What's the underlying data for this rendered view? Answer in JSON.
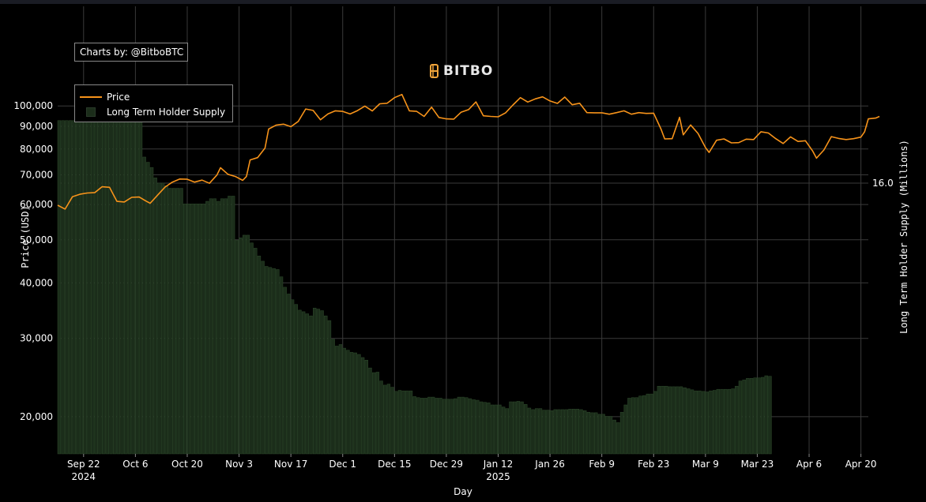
{
  "credit": "Charts by: @BitboBTC",
  "logo": {
    "text": "BITBO",
    "icon": "bitbo-logo-icon"
  },
  "legend": {
    "price_label": "Price",
    "supply_label": "Long Term Holder Supply"
  },
  "colors": {
    "price": "#f7931a",
    "bar_fill": "#1b2d1a",
    "bar_edge": "#2e4a2c",
    "grid": "#3a3a3a",
    "background": "#000000"
  },
  "chart_data": {
    "type": "bar+line",
    "xlabel": "Day",
    "y_left_label": "Price (USD)",
    "y_right_label": "Long Term Holder Supply (Millions)",
    "y_left_scale": "log",
    "y_left_ticks": [
      "20,000",
      "30,000",
      "40,000",
      "50,000",
      "60,000",
      "70,000",
      "80,000",
      "90,000",
      "100,000"
    ],
    "y_left_tick_values": [
      20000,
      30000,
      40000,
      50000,
      60000,
      70000,
      80000,
      90000,
      100000
    ],
    "y_left_range": [
      16500,
      115000
    ],
    "y_right_ticks": [
      "16.0"
    ],
    "y_right_tick_values": [
      16.0
    ],
    "y_right_range": [
      15.48,
      16.2
    ],
    "x_range": [
      "2024-09-15",
      "2025-04-22"
    ],
    "x_ticks": [
      {
        "date": "2024-09-22",
        "label": "Sep 22",
        "sub": "2024"
      },
      {
        "date": "2024-10-06",
        "label": "Oct 6",
        "sub": ""
      },
      {
        "date": "2024-10-20",
        "label": "Oct 20",
        "sub": ""
      },
      {
        "date": "2024-11-03",
        "label": "Nov 3",
        "sub": ""
      },
      {
        "date": "2024-11-17",
        "label": "Nov 17",
        "sub": ""
      },
      {
        "date": "2024-12-01",
        "label": "Dec 1",
        "sub": ""
      },
      {
        "date": "2024-12-15",
        "label": "Dec 15",
        "sub": ""
      },
      {
        "date": "2024-12-29",
        "label": "Dec 29",
        "sub": ""
      },
      {
        "date": "2025-01-12",
        "label": "Jan 12",
        "sub": "2025"
      },
      {
        "date": "2025-01-26",
        "label": "Jan 26",
        "sub": ""
      },
      {
        "date": "2025-02-09",
        "label": "Feb 9",
        "sub": ""
      },
      {
        "date": "2025-02-23",
        "label": "Feb 23",
        "sub": ""
      },
      {
        "date": "2025-03-09",
        "label": "Mar 9",
        "sub": ""
      },
      {
        "date": "2025-03-23",
        "label": "Mar 23",
        "sub": ""
      },
      {
        "date": "2025-04-06",
        "label": "Apr 6",
        "sub": ""
      },
      {
        "date": "2025-04-20",
        "label": "Apr 20",
        "sub": ""
      }
    ],
    "series": [
      {
        "name": "Price",
        "type": "line",
        "points": [
          [
            "2024-09-15",
            59800
          ],
          [
            "2024-09-17",
            58600
          ],
          [
            "2024-09-19",
            62500
          ],
          [
            "2024-09-21",
            63300
          ],
          [
            "2024-09-23",
            63700
          ],
          [
            "2024-09-25",
            63800
          ],
          [
            "2024-09-27",
            65800
          ],
          [
            "2024-09-29",
            65600
          ],
          [
            "2024-10-01",
            61000
          ],
          [
            "2024-10-03",
            60800
          ],
          [
            "2024-10-05",
            62300
          ],
          [
            "2024-10-07",
            62400
          ],
          [
            "2024-10-09",
            61000
          ],
          [
            "2024-10-10",
            60400
          ],
          [
            "2024-10-12",
            63000
          ],
          [
            "2024-10-14",
            65700
          ],
          [
            "2024-10-16",
            67400
          ],
          [
            "2024-10-18",
            68500
          ],
          [
            "2024-10-20",
            68400
          ],
          [
            "2024-10-22",
            67400
          ],
          [
            "2024-10-24",
            68100
          ],
          [
            "2024-10-26",
            67000
          ],
          [
            "2024-10-28",
            69900
          ],
          [
            "2024-10-29",
            72600
          ],
          [
            "2024-10-31",
            70200
          ],
          [
            "2024-11-02",
            69400
          ],
          [
            "2024-11-04",
            68000
          ],
          [
            "2024-11-05",
            69400
          ],
          [
            "2024-11-06",
            75600
          ],
          [
            "2024-11-08",
            76500
          ],
          [
            "2024-11-10",
            80400
          ],
          [
            "2024-11-11",
            88700
          ],
          [
            "2024-11-13",
            90500
          ],
          [
            "2024-11-15",
            91000
          ],
          [
            "2024-11-17",
            89800
          ],
          [
            "2024-11-19",
            92300
          ],
          [
            "2024-11-21",
            98400
          ],
          [
            "2024-11-23",
            97700
          ],
          [
            "2024-11-25",
            93100
          ],
          [
            "2024-11-27",
            95900
          ],
          [
            "2024-11-29",
            97500
          ],
          [
            "2024-12-01",
            97200
          ],
          [
            "2024-12-03",
            95900
          ],
          [
            "2024-12-05",
            97600
          ],
          [
            "2024-12-07",
            99900
          ],
          [
            "2024-12-09",
            97400
          ],
          [
            "2024-12-11",
            101100
          ],
          [
            "2024-12-13",
            101400
          ],
          [
            "2024-12-15",
            104400
          ],
          [
            "2024-12-17",
            106100
          ],
          [
            "2024-12-19",
            97500
          ],
          [
            "2024-12-21",
            97200
          ],
          [
            "2024-12-23",
            94700
          ],
          [
            "2024-12-25",
            99400
          ],
          [
            "2024-12-27",
            94200
          ],
          [
            "2024-12-29",
            93500
          ],
          [
            "2024-12-31",
            93400
          ],
          [
            "2025-01-02",
            96800
          ],
          [
            "2025-01-04",
            98100
          ],
          [
            "2025-01-06",
            102100
          ],
          [
            "2025-01-08",
            95000
          ],
          [
            "2025-01-10",
            94700
          ],
          [
            "2025-01-12",
            94500
          ],
          [
            "2025-01-14",
            96500
          ],
          [
            "2025-01-16",
            100500
          ],
          [
            "2025-01-18",
            104400
          ],
          [
            "2025-01-20",
            102000
          ],
          [
            "2025-01-22",
            103700
          ],
          [
            "2025-01-24",
            104800
          ],
          [
            "2025-01-26",
            102600
          ],
          [
            "2025-01-28",
            101300
          ],
          [
            "2025-01-30",
            104700
          ],
          [
            "2025-02-01",
            100600
          ],
          [
            "2025-02-03",
            101400
          ],
          [
            "2025-02-05",
            96600
          ],
          [
            "2025-02-07",
            96500
          ],
          [
            "2025-02-09",
            96500
          ],
          [
            "2025-02-11",
            95800
          ],
          [
            "2025-02-13",
            96600
          ],
          [
            "2025-02-15",
            97500
          ],
          [
            "2025-02-17",
            95800
          ],
          [
            "2025-02-19",
            96600
          ],
          [
            "2025-02-21",
            96200
          ],
          [
            "2025-02-23",
            96300
          ],
          [
            "2025-02-25",
            88700
          ],
          [
            "2025-02-26",
            84300
          ],
          [
            "2025-02-28",
            84400
          ],
          [
            "2025-03-02",
            94300
          ],
          [
            "2025-03-03",
            86100
          ],
          [
            "2025-03-05",
            90600
          ],
          [
            "2025-03-07",
            86700
          ],
          [
            "2025-03-09",
            80600
          ],
          [
            "2025-03-10",
            78600
          ],
          [
            "2025-03-12",
            83700
          ],
          [
            "2025-03-14",
            84300
          ],
          [
            "2025-03-16",
            82600
          ],
          [
            "2025-03-18",
            82700
          ],
          [
            "2025-03-20",
            84200
          ],
          [
            "2025-03-22",
            84000
          ],
          [
            "2025-03-24",
            87500
          ],
          [
            "2025-03-26",
            86900
          ],
          [
            "2025-03-28",
            84400
          ],
          [
            "2025-03-30",
            82300
          ],
          [
            "2025-04-01",
            85200
          ],
          [
            "2025-04-03",
            83200
          ],
          [
            "2025-04-05",
            83500
          ],
          [
            "2025-04-07",
            79100
          ],
          [
            "2025-04-08",
            76300
          ],
          [
            "2025-04-10",
            79600
          ],
          [
            "2025-04-12",
            85300
          ],
          [
            "2025-04-14",
            84500
          ],
          [
            "2025-04-16",
            84000
          ],
          [
            "2025-04-18",
            84400
          ],
          [
            "2025-04-20",
            85100
          ],
          [
            "2025-04-21",
            87500
          ],
          [
            "2025-04-22",
            93500
          ],
          [
            "2025-04-24",
            93900
          ],
          [
            "2025-04-25",
            94700
          ]
        ]
      },
      {
        "name": "Long Term Holder Supply",
        "type": "bar",
        "start": "2024-09-15",
        "step_days": 1,
        "values": [
          16.12,
          16.12,
          16.12,
          16.12,
          16.12,
          16.12,
          16.12,
          16.125,
          16.128,
          16.13,
          16.125,
          16.12,
          16.12,
          16.12,
          16.12,
          16.12,
          16.12,
          16.12,
          16.12,
          16.12,
          16.125,
          16.125,
          16.125,
          16.05,
          16.04,
          16.03,
          16.01,
          16.0,
          16.0,
          15.995,
          15.99,
          15.99,
          15.99,
          15.99,
          15.96,
          15.96,
          15.96,
          15.96,
          15.96,
          15.96,
          15.965,
          15.97,
          15.97,
          15.965,
          15.97,
          15.97,
          15.975,
          15.975,
          15.89,
          15.895,
          15.9,
          15.9,
          15.885,
          15.875,
          15.86,
          15.85,
          15.84,
          15.838,
          15.836,
          15.834,
          15.82,
          15.8,
          15.787,
          15.776,
          15.767,
          15.756,
          15.753,
          15.749,
          15.745,
          15.76,
          15.758,
          15.755,
          15.745,
          15.736,
          15.7,
          15.687,
          15.69,
          15.683,
          15.679,
          15.675,
          15.674,
          15.671,
          15.665,
          15.66,
          15.645,
          15.636,
          15.637,
          15.62,
          15.612,
          15.614,
          15.608,
          15.6,
          15.602,
          15.601,
          15.601,
          15.601,
          15.59,
          15.588,
          15.587,
          15.587,
          15.589,
          15.589,
          15.587,
          15.587,
          15.585,
          15.585,
          15.585,
          15.586,
          15.589,
          15.589,
          15.588,
          15.586,
          15.584,
          15.583,
          15.58,
          15.579,
          15.578,
          15.574,
          15.574,
          15.574,
          15.57,
          15.567,
          15.58,
          15.58,
          15.581,
          15.58,
          15.575,
          15.568,
          15.565,
          15.567,
          15.567,
          15.564,
          15.564,
          15.563,
          15.565,
          15.565,
          15.565,
          15.565,
          15.566,
          15.566,
          15.566,
          15.565,
          15.563,
          15.56,
          15.559,
          15.559,
          15.556,
          15.556,
          15.552,
          15.552,
          15.545,
          15.54,
          15.56,
          15.574,
          15.587,
          15.588,
          15.588,
          15.591,
          15.592,
          15.595,
          15.595,
          15.6,
          15.61,
          15.61,
          15.61,
          15.609,
          15.609,
          15.609,
          15.609,
          15.607,
          15.605,
          15.603,
          15.601,
          15.601,
          15.6,
          15.599,
          15.601,
          15.602,
          15.604,
          15.604,
          15.604,
          15.604,
          15.605,
          15.61,
          15.62,
          15.622,
          15.625,
          15.625,
          15.626,
          15.626,
          15.627,
          15.63,
          15.629
        ]
      }
    ]
  }
}
